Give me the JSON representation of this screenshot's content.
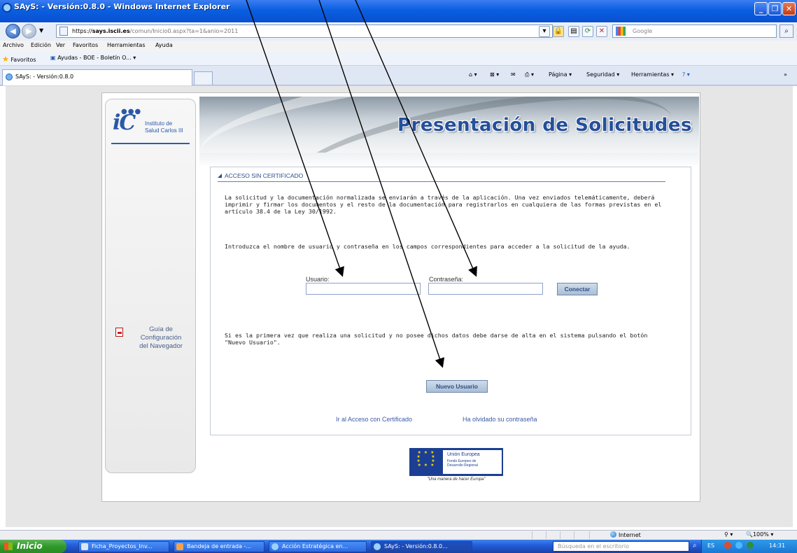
{
  "window": {
    "title": "SAyS: - Versión:0.8.0 - Windows Internet Explorer",
    "min_glyph": "_",
    "max_glyph": "❐",
    "close_glyph": "✕"
  },
  "address": {
    "scheme": "https://",
    "host": "says.iscii.es",
    "path": "/comun/Inicio0.aspx?ta=1&anio=2011"
  },
  "search": {
    "placeholder": "Google"
  },
  "menu": [
    "Archivo",
    "Edición",
    "Ver",
    "Favoritos",
    "Herramientas",
    "Ayuda"
  ],
  "favorites": {
    "label": "Favoritos",
    "link": "Ayudas - BOE - Boletín O..."
  },
  "tab": {
    "label": "SAyS: - Versión:0.8.0"
  },
  "commandbar": {
    "page": "Página",
    "security": "Seguridad",
    "tools": "Herramientas"
  },
  "logo": {
    "mark": "iC",
    "line1": "Instituto de",
    "line2": "Salud Carlos III"
  },
  "banner": {
    "title": "Presentación de Solicitudes"
  },
  "sidebar": {
    "guide_line1": "Guía de",
    "guide_line2": "Configuración",
    "guide_line3": "del Navegador"
  },
  "access": {
    "heading": "ACCESO SIN CERTIFICADO",
    "intro_line1": "La solicitud y la documentación normalizada se enviarán a través de la aplicación. Una vez enviados telemáticamente, deberá",
    "intro_line2": "imprimir y firmar los documentos y el resto de la documentación para registrarlos en cualquiera de las formas previstas en el",
    "intro_line3": "artículo 38.4 de la Ley 30/1992.",
    "instructions": "Introduzca el nombre de usuario y contraseña en los campos correspondientes para acceder a la solicitud de la ayuda.",
    "user_label": "Usuario:",
    "user_value": "",
    "password_label": "Contraseña:",
    "password_value": "",
    "connect_button": "Conectar",
    "first_time_line1": "Si es la primera vez que realiza una solicitud y no posee dichos datos debe darse de alta en el sistema pulsando el botón",
    "first_time_line2": "\"Nuevo Usuario\".",
    "new_user_button": "Nuevo Usuario",
    "cert_link": "Ir al Acceso con Certificado",
    "forgot_link": "Ha olvidado su contraseña"
  },
  "eu": {
    "title": "Unión Europea",
    "fund_line1": "Fondo Europeo de",
    "fund_line2": "Desarrollo Regional",
    "motto": "\"Una manera de hacer Europa\""
  },
  "statusbar": {
    "zone": "Internet",
    "zoom": "100%"
  },
  "taskbar": {
    "start": "Inicio",
    "items": [
      "Ficha_Proyectos_Inv...",
      "Bandeja de entrada -...",
      "Acción Estratégica en...",
      "SAyS: - Versión:0.8.0..."
    ],
    "desktop_search": "Búsqueda en el escritorio",
    "language": "ES",
    "clock": "14:31"
  },
  "colors": {
    "title_blue": "#0a5fe0",
    "heading_blue": "#2d4f8f",
    "banner_title": "#254f9a",
    "link_blue": "#3b5aa7",
    "start_green": "#2f9a2a"
  }
}
